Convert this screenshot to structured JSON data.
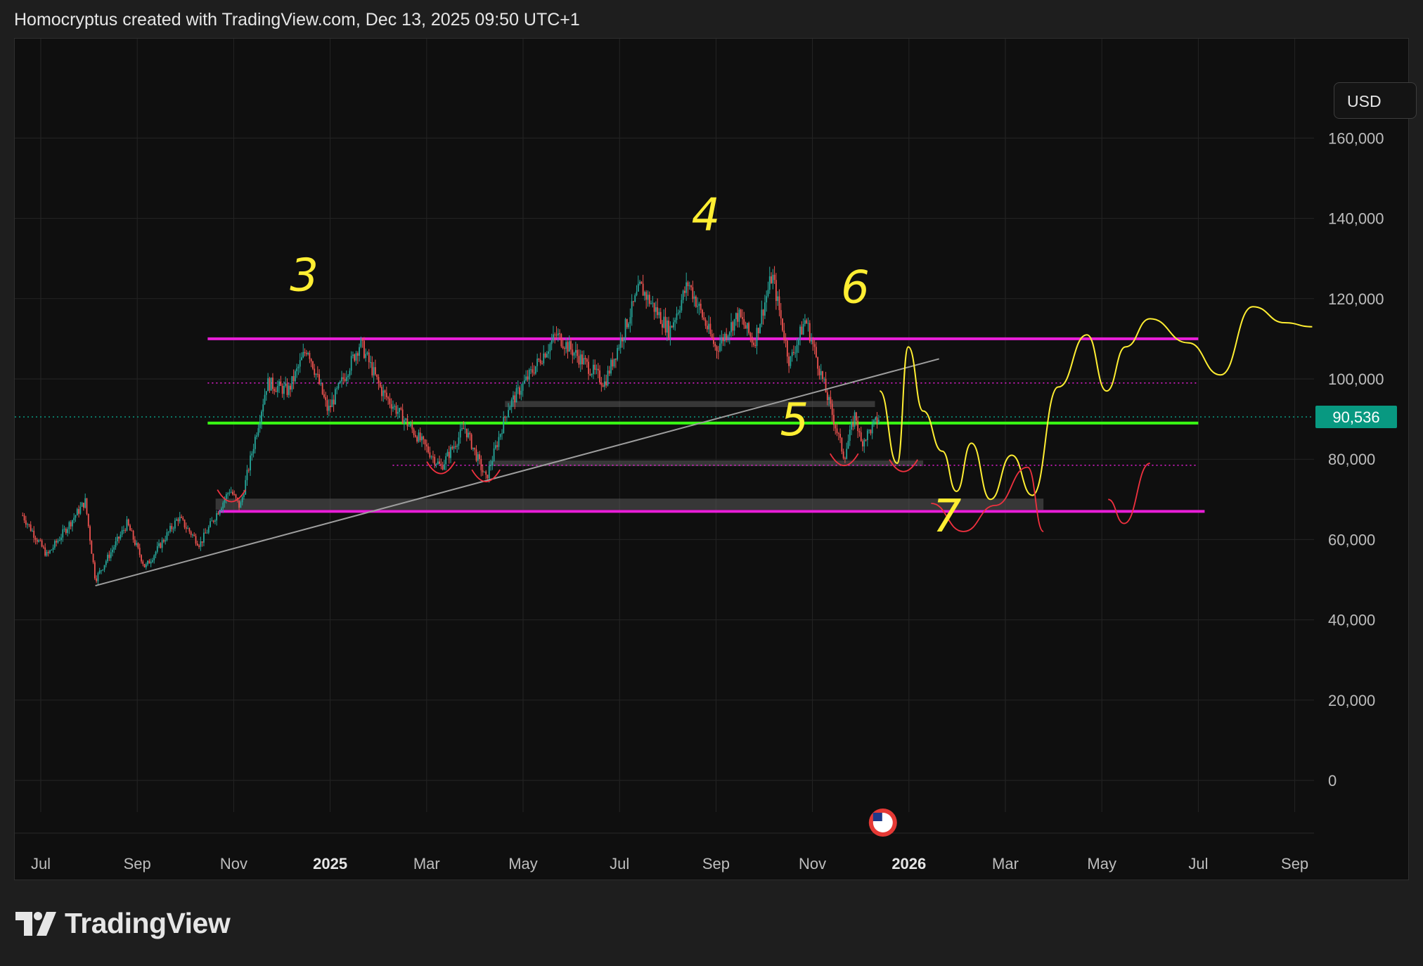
{
  "header": {
    "credit": "Homocryptus created with TradingView.com, Dec 13, 2025 09:50 UTC+1"
  },
  "currency": {
    "label": "USD"
  },
  "branding": {
    "name": "TradingView",
    "logo_icon": "tradingview-logo-icon"
  },
  "events": {
    "flag_icon": "us-flag-icon"
  },
  "colors": {
    "background": "#0f0f0f",
    "grid": "#242424",
    "up_candle": "#26a69a",
    "down_candle": "#ef5350",
    "magenta_level": "#e91ed8",
    "green_level": "#39ff14",
    "trendline": "#9e9e9e",
    "drawing_yellow": "#ffee32",
    "drawing_red": "#f0313f",
    "last_price_bg": "#089981"
  },
  "chart_data": {
    "type": "candlestick",
    "title": "",
    "xlabel": "",
    "ylabel": "",
    "ylim": [
      -20000,
      180000
    ],
    "x_range": [
      "2024-06-20",
      "2026-09-25"
    ],
    "grid": true,
    "y_ticks": [
      0,
      20000,
      40000,
      60000,
      80000,
      100000,
      120000,
      140000,
      160000
    ],
    "y_tick_labels": [
      "0",
      "20,000",
      "40,000",
      "60,000",
      "80,000",
      "100,000",
      "120,000",
      "140,000",
      "160,000"
    ],
    "x_ticks": [
      {
        "date": "2024-07-01",
        "label": "Jul",
        "bold": false
      },
      {
        "date": "2024-09-01",
        "label": "Sep",
        "bold": false
      },
      {
        "date": "2024-11-01",
        "label": "Nov",
        "bold": false
      },
      {
        "date": "2025-01-01",
        "label": "2025",
        "bold": true
      },
      {
        "date": "2025-03-01",
        "label": "Mar",
        "bold": false
      },
      {
        "date": "2025-05-01",
        "label": "May",
        "bold": false
      },
      {
        "date": "2025-07-01",
        "label": "Jul",
        "bold": false
      },
      {
        "date": "2025-09-01",
        "label": "Sep",
        "bold": false
      },
      {
        "date": "2025-11-01",
        "label": "Nov",
        "bold": false
      },
      {
        "date": "2026-01-01",
        "label": "2026",
        "bold": true
      },
      {
        "date": "2026-03-01",
        "label": "Mar",
        "bold": false
      },
      {
        "date": "2026-05-01",
        "label": "May",
        "bold": false
      },
      {
        "date": "2026-07-01",
        "label": "Jul",
        "bold": false
      },
      {
        "date": "2026-09-01",
        "label": "Sep",
        "bold": false
      }
    ],
    "last_price": {
      "value": 90536,
      "label": "90,536"
    },
    "price_path": [
      [
        "2024-06-20",
        66000
      ],
      [
        "2024-07-05",
        56000
      ],
      [
        "2024-07-29",
        69500
      ],
      [
        "2024-08-05",
        50000
      ],
      [
        "2024-08-25",
        64000
      ],
      [
        "2024-09-06",
        53000
      ],
      [
        "2024-09-27",
        65500
      ],
      [
        "2024-10-10",
        58800
      ],
      [
        "2024-10-29",
        72500
      ],
      [
        "2024-11-05",
        68000
      ],
      [
        "2024-11-22",
        99000
      ],
      [
        "2024-12-05",
        97000
      ],
      [
        "2024-12-17",
        108000
      ],
      [
        "2024-12-30",
        92000
      ],
      [
        "2025-01-20",
        109000
      ],
      [
        "2025-02-03",
        97000
      ],
      [
        "2025-02-25",
        86000
      ],
      [
        "2025-03-10",
        78000
      ],
      [
        "2025-03-25",
        88000
      ],
      [
        "2025-04-08",
        75000
      ],
      [
        "2025-04-22",
        93000
      ],
      [
        "2025-05-22",
        111000
      ],
      [
        "2025-06-22",
        99000
      ],
      [
        "2025-07-14",
        123000
      ],
      [
        "2025-08-02",
        112000
      ],
      [
        "2025-08-14",
        124000
      ],
      [
        "2025-09-01",
        107500
      ],
      [
        "2025-09-15",
        116000
      ],
      [
        "2025-09-25",
        109000
      ],
      [
        "2025-10-06",
        126000
      ],
      [
        "2025-10-17",
        104000
      ],
      [
        "2025-10-27",
        115000
      ],
      [
        "2025-11-21",
        80500
      ],
      [
        "2025-11-28",
        91500
      ],
      [
        "2025-12-01",
        84000
      ],
      [
        "2025-12-13",
        90536
      ]
    ],
    "annotations": {
      "labels": [
        "3",
        "4",
        "5",
        "6",
        "7"
      ],
      "horizontal_levels": [
        {
          "name": "magenta-resistance",
          "value": 110000,
          "style": "solid"
        },
        {
          "name": "green-support",
          "value": 89000,
          "style": "solid"
        },
        {
          "name": "magenta-support",
          "value": 67000,
          "style": "solid"
        },
        {
          "name": "dotted-upper",
          "value": 99000,
          "style": "dotted"
        },
        {
          "name": "dotted-lower",
          "value": 78500,
          "style": "dotted"
        }
      ],
      "trendline": [
        [
          "2024-08-05",
          48500
        ],
        [
          "2026-01-20",
          105000
        ]
      ],
      "zones": [
        {
          "from": "2025-04-20",
          "to": "2025-12-10",
          "low": 93000,
          "high": 94500
        },
        {
          "from": "2025-04-10",
          "to": "2026-01-10",
          "low": 78300,
          "high": 79700
        },
        {
          "from": "2024-10-20",
          "to": "2026-03-25",
          "low": 67400,
          "high": 70200
        }
      ],
      "projection_yellow": [
        [
          "2025-12-13",
          97000
        ],
        [
          "2025-12-24",
          79000
        ],
        [
          "2025-12-31",
          108000
        ],
        [
          "2026-01-10",
          92000
        ],
        [
          "2026-01-22",
          82000
        ],
        [
          "2026-01-31",
          72000
        ],
        [
          "2026-02-10",
          84000
        ],
        [
          "2026-02-22",
          70000
        ],
        [
          "2026-03-05",
          81000
        ],
        [
          "2026-03-18",
          71000
        ],
        [
          "2026-04-04",
          98000
        ],
        [
          "2026-04-22",
          111000
        ],
        [
          "2026-05-04",
          97000
        ],
        [
          "2026-05-16",
          108000
        ],
        [
          "2026-06-01",
          115000
        ],
        [
          "2026-06-25",
          109000
        ],
        [
          "2026-07-15",
          101000
        ],
        [
          "2026-08-05",
          118000
        ],
        [
          "2026-08-25",
          114000
        ],
        [
          "2026-09-12",
          113000
        ]
      ],
      "projection_red": [
        [
          "2026-01-15",
          69000
        ],
        [
          "2026-02-05",
          62000
        ],
        [
          "2026-02-25",
          68500
        ],
        [
          "2026-03-15",
          78000
        ],
        [
          "2026-03-25",
          62000
        ],
        [
          "2026-05-05",
          70000
        ],
        [
          "2026-05-15",
          64000
        ],
        [
          "2026-06-01",
          79000
        ]
      ]
    }
  }
}
